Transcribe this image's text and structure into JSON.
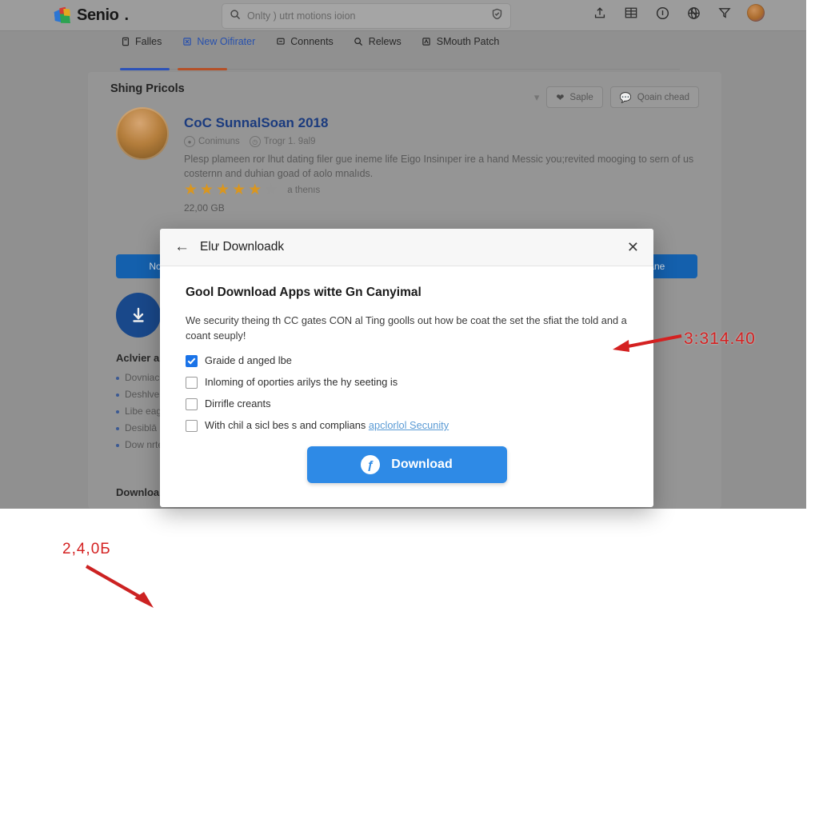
{
  "topbar": {
    "logo_text": "Senio",
    "logo_dot": ".",
    "logo_icon": "cube-logo-icon",
    "search": {
      "icon": "search-icon",
      "value": "Onlty ) utrt motions ioion",
      "placeholder": "Onlty ) utrt motions ioion",
      "trailing_icon": "shield-check-icon"
    },
    "icons": [
      {
        "name": "share-upload-icon",
        "glyph": "⇧"
      },
      {
        "name": "table-grid-icon",
        "glyph": "▦"
      },
      {
        "name": "info-circle-icon",
        "glyph": "ⓘ"
      },
      {
        "name": "globe-help-icon",
        "glyph": "⊕"
      },
      {
        "name": "filter-funnel-icon",
        "glyph": "▽"
      }
    ],
    "avatar": "user-avatar"
  },
  "tabs": [
    {
      "label": "Falles",
      "icon": "file-icon",
      "glyph": "☰",
      "active": false
    },
    {
      "label": "New Oifirater",
      "icon": "new-item-icon",
      "glyph": "⚑",
      "active": true
    },
    {
      "label": "Connents",
      "icon": "comment-icon",
      "glyph": "▣",
      "active": false
    },
    {
      "label": "Relews",
      "icon": "search-icon",
      "glyph": "⚲",
      "active": false
    },
    {
      "label": "SMouth Patch",
      "icon": "patch-icon",
      "glyph": "☰",
      "active": false
    }
  ],
  "card": {
    "title": "Shing Pricols",
    "post": {
      "avatar": "post-author-avatar",
      "title": "CoC SunnalSoan 2018",
      "meta": [
        {
          "label": "Conimuns",
          "icon": "category-icon"
        },
        {
          "label": "Trogr 1. 9al9",
          "icon": "clock-icon"
        }
      ],
      "body": "Plesp plameen ror lhut dating filer gue ineme life Eigo Insinıper ire a hand Messic you;revited mooging to sern of us costernn and duhian goad of aolo mnalıds.",
      "stars_filled": 5,
      "stars_total": 6,
      "stars_label": "a  thenıs",
      "filesize": "22,00 GB"
    },
    "actions": {
      "chevron": "chevron-down-icon",
      "like": {
        "label": "Saple",
        "icon": "heart-icon"
      },
      "comment": {
        "label": "Qoain chead",
        "icon": "comment-icon"
      }
    },
    "button_left": "No urc",
    "button_right": "d gane",
    "download_icon": "download-circle-icon",
    "section_heading": "Aclvier a",
    "bullets": [
      "Dovniac",
      "Deshlve",
      "Libe eag",
      "Desiblā",
      "Dow nrte"
    ],
    "section_heading_2": "Downloa",
    "side_link": "ne"
  },
  "modal": {
    "back_icon": "back-arrow-icon",
    "title": "Elư Downloadk",
    "close_icon": "close-icon",
    "heading": "Gool Download Apps witte Gn Canyimal",
    "paragraph": "We security theing th CC gates CON al Ting goolls out how be coat the set the sfiat the told and a coant seuply!",
    "checkboxes": [
      {
        "label": "Graide d anged lbe",
        "checked": true,
        "link": ""
      },
      {
        "label": "Inloming of oporties arilys the hy seeting is",
        "checked": false,
        "link": ""
      },
      {
        "label": "Dirrifle creants",
        "checked": false,
        "link": ""
      },
      {
        "label": "With chil a sicl bes s and complians ",
        "checked": false,
        "link": "apclorlol Secunity"
      }
    ],
    "download_button": {
      "label": "Download",
      "icon": "download-badge-icon",
      "glyph": "ƒ"
    }
  },
  "annotations": {
    "right_value": "3:314.40",
    "left_value": "2,4,0Б",
    "color": "#d42121"
  }
}
